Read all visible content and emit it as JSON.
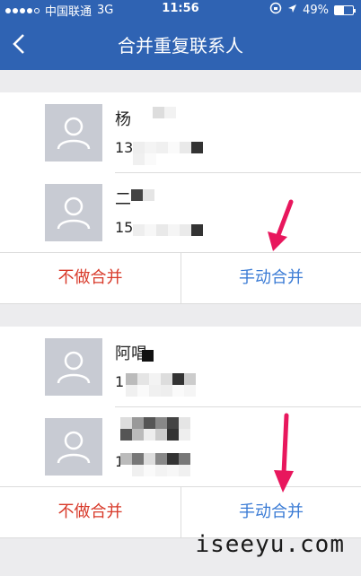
{
  "status_bar": {
    "carrier": "中国联通",
    "network": "3G",
    "time": "11:56",
    "battery_text": "49%",
    "battery_level": 0.49
  },
  "nav": {
    "title": "合并重复联系人"
  },
  "groups": [
    {
      "contacts": [
        {
          "name": "杨",
          "phone": "13"
        },
        {
          "name": "二",
          "phone": "15"
        }
      ],
      "skip_label": "不做合并",
      "merge_label": "手动合并"
    },
    {
      "contacts": [
        {
          "name": "阿唱",
          "phone": "1"
        },
        {
          "name": "",
          "phone": "1"
        }
      ],
      "skip_label": "不做合并",
      "merge_label": "手动合并"
    }
  ],
  "watermark": "iseeyu.com",
  "colors": {
    "header": "#2f63b3",
    "skip": "#d83a2a",
    "merge": "#3a7bd5",
    "arrow": "#e8175d"
  }
}
